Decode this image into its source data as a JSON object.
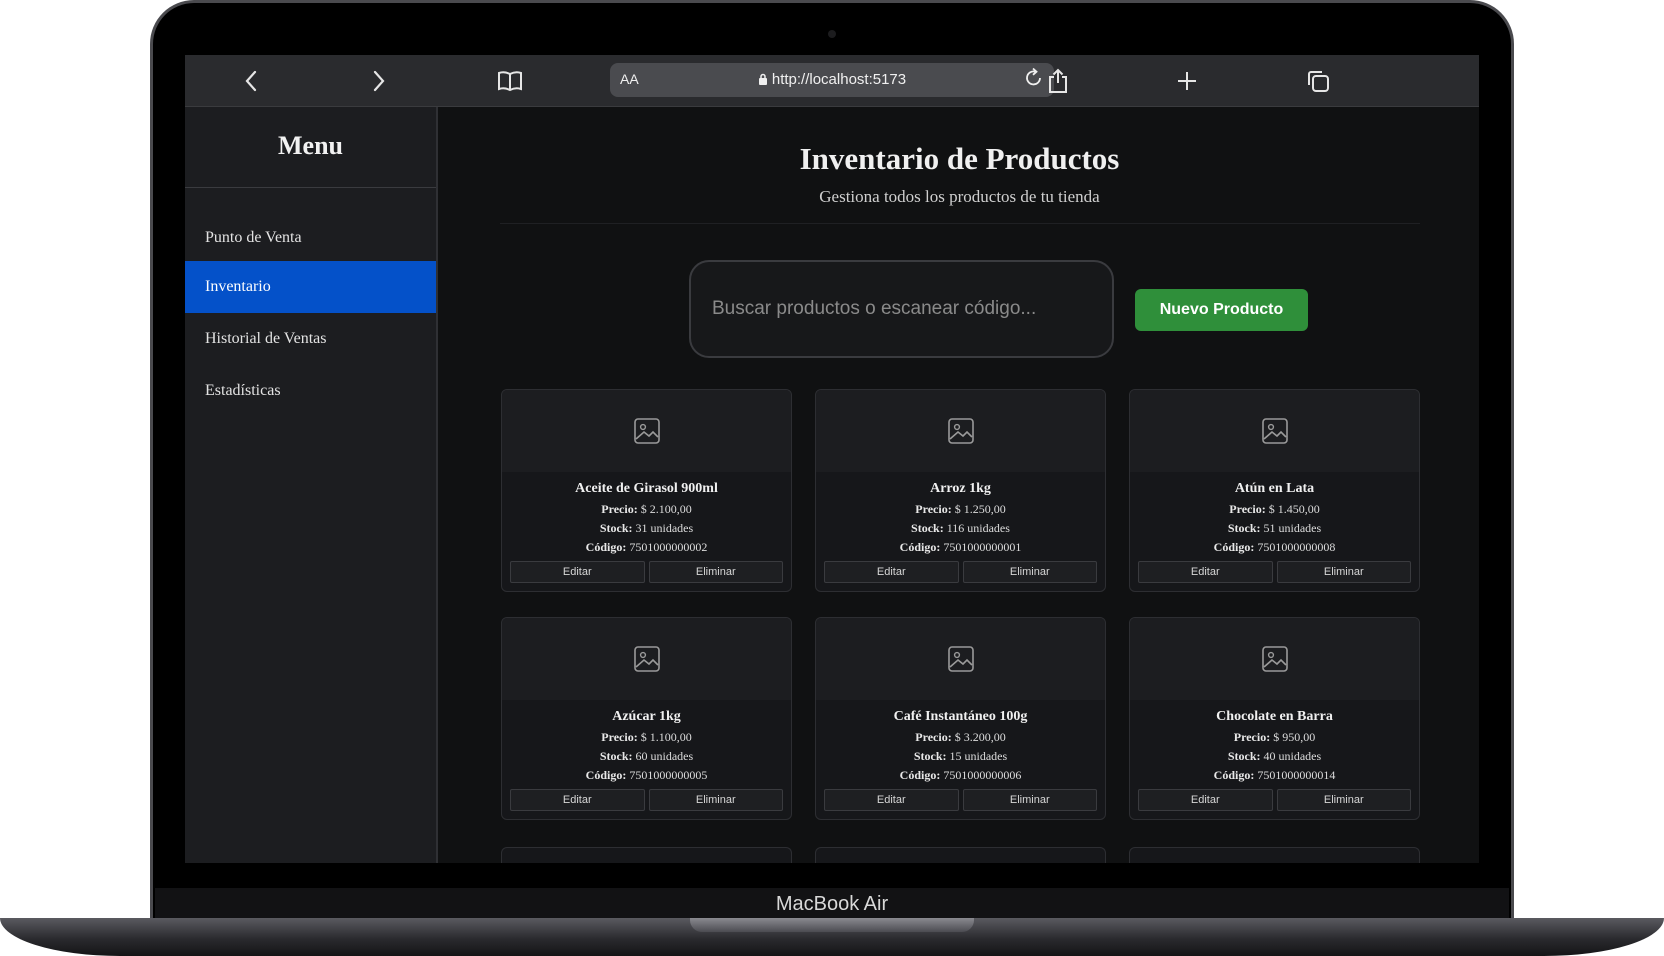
{
  "device": {
    "label": "MacBook Air"
  },
  "browser": {
    "text_size_label": "AA",
    "url": "http://localhost:5173",
    "icons": [
      "back-icon",
      "forward-icon",
      "bookmarks-icon",
      "lock-icon",
      "reload-icon",
      "share-icon",
      "new-tab-icon",
      "tabs-icon"
    ]
  },
  "sidebar": {
    "title": "Menu",
    "items": [
      {
        "label": "Punto de Venta",
        "active": false
      },
      {
        "label": "Inventario",
        "active": true
      },
      {
        "label": "Historial de Ventas",
        "active": false
      },
      {
        "label": "Estadísticas",
        "active": false
      }
    ]
  },
  "header": {
    "title": "Inventario de Productos",
    "subtitle": "Gestiona todos los productos de tu tienda"
  },
  "toolbar": {
    "search_placeholder": "Buscar productos o escanear código...",
    "new_product_label": "Nuevo Producto"
  },
  "labels": {
    "price": "Precio:",
    "stock": "Stock:",
    "code": "Código:",
    "edit": "Editar",
    "delete": "Eliminar"
  },
  "products": [
    {
      "name": "Aceite de Girasol 900ml",
      "price": "$ 2.100,00",
      "stock": "31 unidades",
      "code": "7501000000002"
    },
    {
      "name": "Arroz 1kg",
      "price": "$ 1.250,00",
      "stock": "116 unidades",
      "code": "7501000000001"
    },
    {
      "name": "Atún en Lata",
      "price": "$ 1.450,00",
      "stock": "51 unidades",
      "code": "7501000000008"
    },
    {
      "name": "Azúcar 1kg",
      "price": "$ 1.100,00",
      "stock": "60 unidades",
      "code": "7501000000005"
    },
    {
      "name": "Café Instantáneo 100g",
      "price": "$ 3.200,00",
      "stock": "15 unidades",
      "code": "7501000000006"
    },
    {
      "name": "Chocolate en Barra",
      "price": "$ 950,00",
      "stock": "40 unidades",
      "code": "7501000000014"
    }
  ],
  "colors": {
    "active_nav": "#0451c9",
    "primary_button": "#2f8f3a",
    "background": "#101112"
  }
}
